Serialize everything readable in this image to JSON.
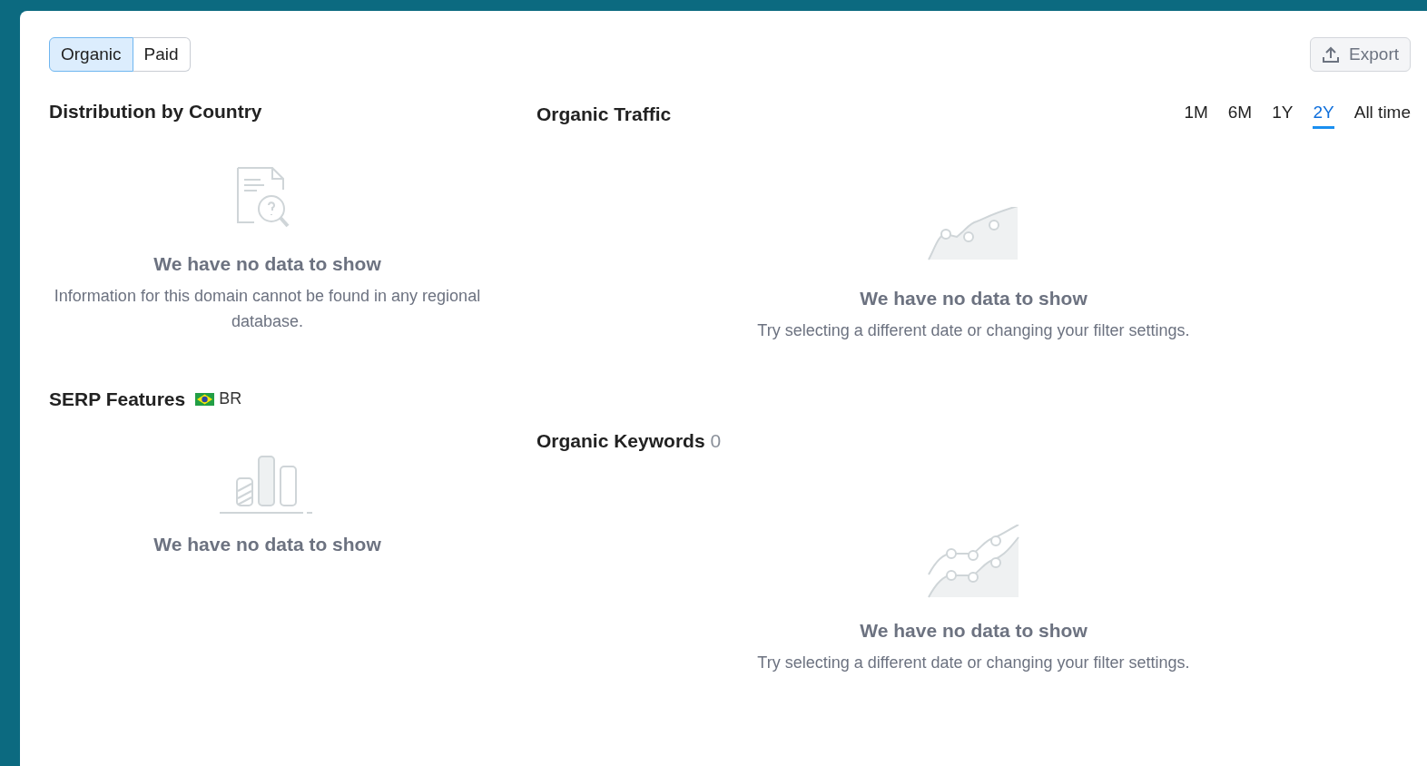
{
  "source_tabs": [
    {
      "label": "Organic",
      "selected": true
    },
    {
      "label": "Paid",
      "selected": false
    }
  ],
  "export_button": {
    "label": "Export"
  },
  "distribution": {
    "title": "Distribution by Country",
    "empty": {
      "title": "We have no data to show",
      "message": "Information for this domain cannot be found in any regional database."
    }
  },
  "serp_features": {
    "title": "SERP Features",
    "country": "BR",
    "empty": {
      "title": "We have no data to show"
    }
  },
  "organic_traffic": {
    "title": "Organic Traffic",
    "periods": [
      {
        "label": "1M",
        "selected": false
      },
      {
        "label": "6M",
        "selected": false
      },
      {
        "label": "1Y",
        "selected": false
      },
      {
        "label": "2Y",
        "selected": true
      },
      {
        "label": "All time",
        "selected": false
      }
    ],
    "empty": {
      "title": "We have no data to show",
      "message": "Try selecting a different date or changing your filter settings."
    }
  },
  "organic_keywords": {
    "title": "Organic Keywords",
    "count": "0",
    "empty": {
      "title": "We have no data to show",
      "message": "Try selecting a different date or changing your filter settings."
    }
  }
}
